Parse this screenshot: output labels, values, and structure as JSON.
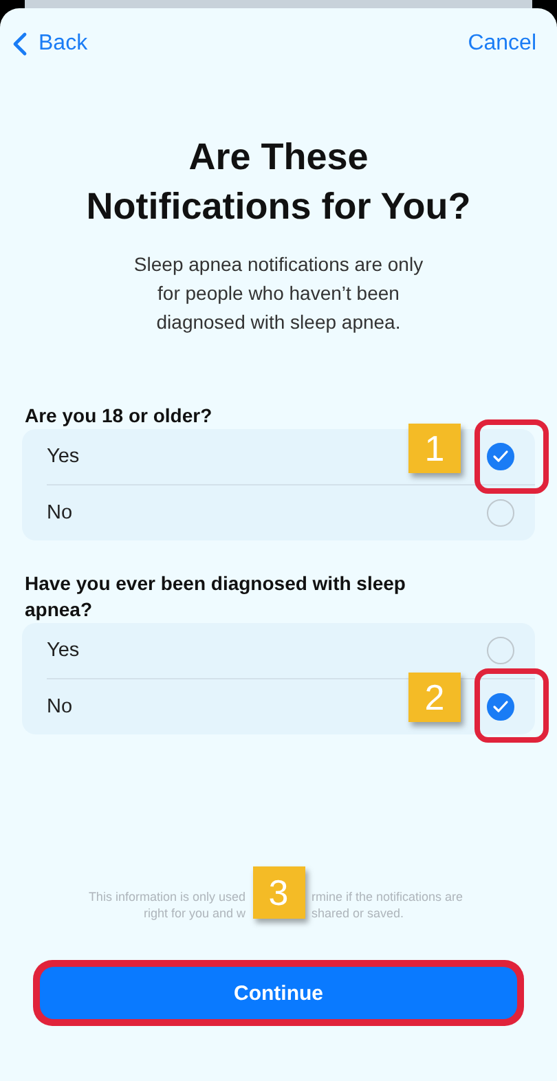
{
  "nav": {
    "back": "Back",
    "cancel": "Cancel"
  },
  "title": "Are These Notifications for You?",
  "description": "Sleep apnea notifications are only for people who haven’t been diagnosed with sleep apnea.",
  "questions": [
    {
      "label": "Are you 18 or older?",
      "options": [
        {
          "label": "Yes",
          "selected": true,
          "highlighted": true,
          "callout": "1"
        },
        {
          "label": "No",
          "selected": false,
          "highlighted": false
        }
      ]
    },
    {
      "label": "Have you ever been diagnosed with sleep apnea?",
      "options": [
        {
          "label": "Yes",
          "selected": false,
          "highlighted": false
        },
        {
          "label": "No",
          "selected": true,
          "highlighted": true,
          "callout": "2"
        }
      ]
    }
  ],
  "footnote": {
    "lines": [
      {
        "left": "This information is only used",
        "right": "rmine if the notifications are"
      },
      {
        "left": "right for you and w",
        "right": "shared or saved."
      }
    ],
    "callout": "3"
  },
  "continue_button": {
    "label": "Continue",
    "highlighted": true
  }
}
